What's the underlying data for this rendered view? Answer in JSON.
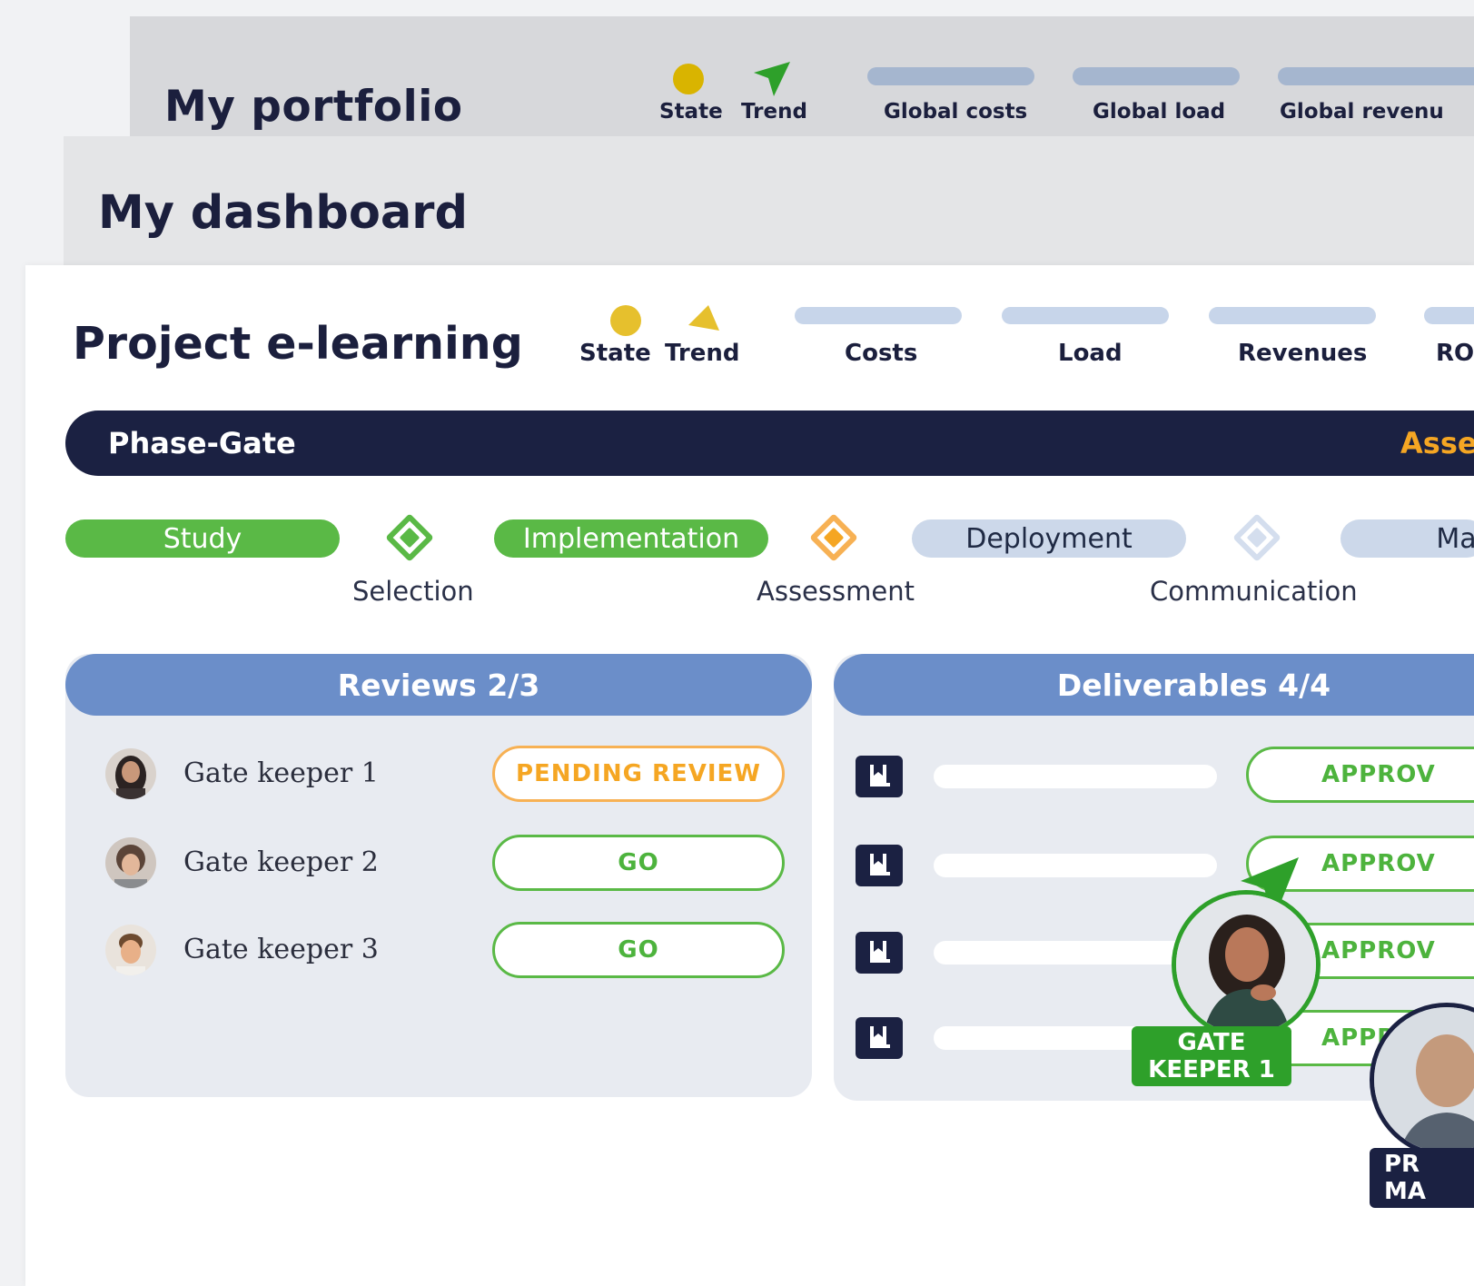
{
  "portfolio": {
    "title": "My portfolio",
    "state_label": "State",
    "trend_label": "Trend",
    "kpis": [
      "Global costs",
      "Global load",
      "Global revenu"
    ]
  },
  "dashboard": {
    "title": "My dashboard"
  },
  "project": {
    "title": "Project e-learning",
    "state_label": "State",
    "trend_label": "Trend",
    "kpis": [
      "Costs",
      "Load",
      "Revenues",
      "RO"
    ]
  },
  "phase_gate": {
    "label": "Phase-Gate",
    "current": "Asses"
  },
  "phases": [
    {
      "label": "Study",
      "status": "done"
    },
    {
      "label": "Implementation",
      "status": "done"
    },
    {
      "label": "Deployment",
      "status": "todo"
    },
    {
      "label": "Mai",
      "status": "todo"
    }
  ],
  "gates": [
    {
      "label": "Selection",
      "status": "passed"
    },
    {
      "label": "Assessment",
      "status": "current"
    },
    {
      "label": "Communication",
      "status": "upcoming"
    }
  ],
  "reviews": {
    "header": "Reviews 2/3",
    "rows": [
      {
        "name": "Gate keeper 1",
        "status": "PENDING REVIEW"
      },
      {
        "name": "Gate keeper 2",
        "status": "GO"
      },
      {
        "name": "Gate keeper 3",
        "status": "GO"
      }
    ]
  },
  "deliverables": {
    "header": "Deliverables 4/4",
    "rows": [
      {
        "status": "APPROV"
      },
      {
        "status": "APPROV"
      },
      {
        "status": "APPROV"
      },
      {
        "status": "APPR"
      }
    ]
  },
  "overlay": {
    "badge_line1": "GATE",
    "badge_line2": "KEEPER 1",
    "badge2_line1": "PR",
    "badge2_line2": "MA"
  },
  "colors": {
    "navy": "#1b2142",
    "green": "#5ab946",
    "orange": "#f5a623",
    "blue_header": "#6b8ec9",
    "state_yellow": "#d9b400"
  }
}
